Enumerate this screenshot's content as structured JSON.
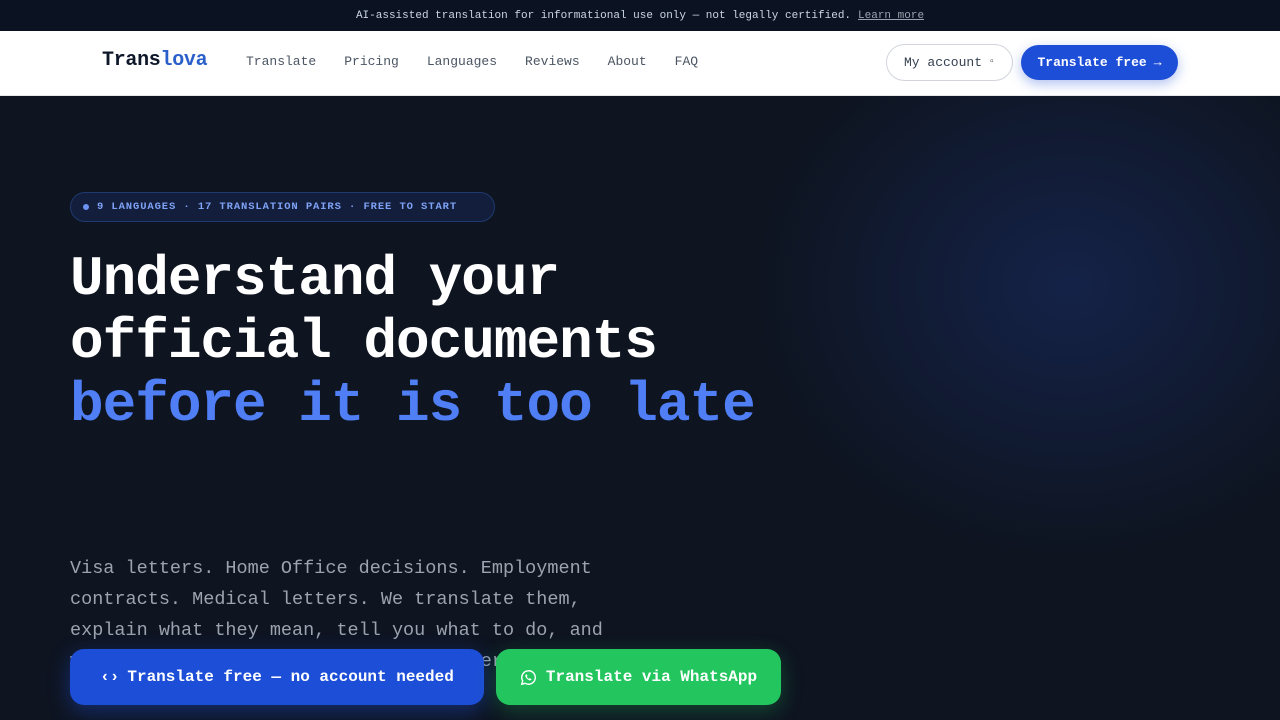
{
  "notice": {
    "text": "AI-assisted translation for informational use only — not legally certified.",
    "link": "Learn more"
  },
  "nav": {
    "brand_part1": "Trans",
    "brand_part2": "lova",
    "links": [
      "Translate",
      "Pricing",
      "Languages",
      "Reviews",
      "About",
      "FAQ"
    ],
    "account_label": "My account",
    "account_icon": "▫",
    "cta_label": "Translate free",
    "cta_arrow": "→"
  },
  "hero": {
    "badge": "9 LANGUAGES · 17 TRANSLATION PAIRS · FREE TO START",
    "headline_line1": "Understand your",
    "headline_line2": "official documents",
    "headline_line3": "before it is too late",
    "description": "Visa letters. Home Office decisions. Employment contracts. Medical letters. We translate them, explain what they mean, tell you what to do, and warn you about any deadlines — in under 30 seconds.",
    "primary_button_icon": "‹›",
    "primary_button": "Translate free — no account needed",
    "whatsapp_button": "Translate via WhatsApp"
  },
  "colors": {
    "accent_blue": "#1d4ed8",
    "headline_highlight": "#4f7ef5",
    "whatsapp_green": "#22c55e",
    "background": "#0e1420"
  },
  "icons": {
    "account": "user-square-icon",
    "primary_cta": "code-brackets-icon",
    "whatsapp": "whatsapp-icon"
  }
}
